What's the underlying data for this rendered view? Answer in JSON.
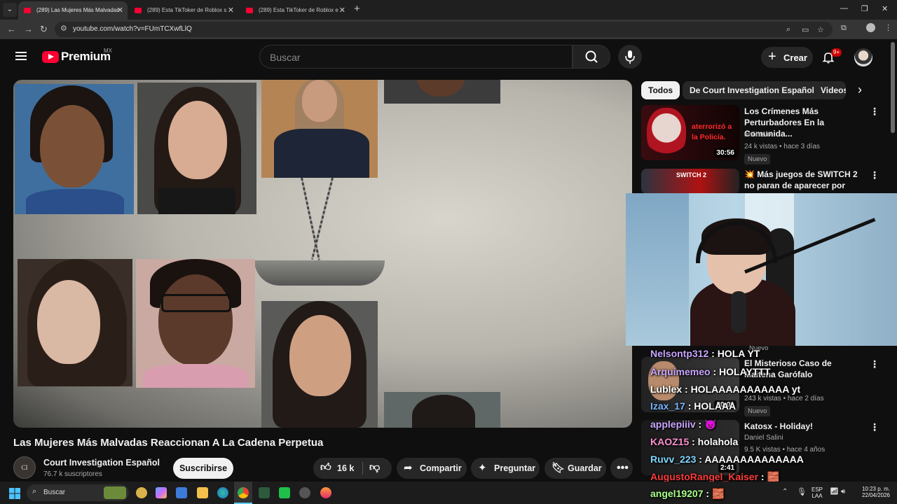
{
  "browser": {
    "tabs": [
      {
        "label": "(289) Las Mujeres Más Malvadas",
        "active": true
      },
      {
        "label": "(289) Esta TikToker de Roblox s",
        "active": false
      },
      {
        "label": "(289) Esta TikToker de Roblox e",
        "active": false
      }
    ],
    "url": "youtube.com/watch?v=FUmTCXwfLlQ"
  },
  "header": {
    "brand": "Premium",
    "country": "MX",
    "search_placeholder": "Buscar",
    "create_label": "Crear",
    "notif_count": "9+"
  },
  "video": {
    "title": "Las Mujeres Más Malvadas Reaccionan A La Cadena Perpetua",
    "channel": "Court Investigation Español",
    "channel_initials": "CI",
    "subscribers": "76.7 k suscriptores",
    "subscribe_label": "Suscribirse",
    "likes": "16 k",
    "share_label": "Compartir",
    "ask_label": "Preguntar",
    "save_label": "Guardar"
  },
  "chips": [
    "Todos",
    "De Court Investigation Español",
    "Videos"
  ],
  "recommendations": [
    {
      "title": "Los Crímenes Más Perturbadores En la Comunida...",
      "channel": "anómalo",
      "meta": "24 k vistas • hace 3 días",
      "badge": "Nuevo",
      "duration": "30:56",
      "thumb_text": "aterrorizó a la Policía."
    },
    {
      "title": "Más juegos de SWITCH 2 no paran de aparecer por sorpresa!",
      "emoji": "💥",
      "thumb_text": "SWITCH 2"
    },
    {
      "title": "El Misterioso Caso de Maitena Garófalo",
      "meta": "243 k vistas • hace 2 días",
      "badge": "Nuevo",
      "duration": "20:01",
      "partial_badge": "Nuevo"
    },
    {
      "title": "Katosx - Holiday!",
      "channel": "Daniel Salini",
      "meta": "9.5 K vistas • hace 4 años",
      "duration": "2:41"
    }
  ],
  "chat": [
    {
      "user": "Nelsontp312",
      "msg": " : HOLA YT",
      "color": "#c9a6ff"
    },
    {
      "user": "Arquimemeo",
      "msg": " : HOLAYTTT",
      "color": "#c9a6ff"
    },
    {
      "user": "Lublex",
      "msg": " : HOLAAAAAAAAAAA yt",
      "color": "#ffffff"
    },
    {
      "user": "Izax_17",
      "msg": " : HOLAAA",
      "color": "#7ab6ff"
    },
    {
      "user": "applepiiiv",
      "msg": " : 👿",
      "color": "#c9a6ff"
    },
    {
      "user": "KAOZ15",
      "msg": " : holahola",
      "color": "#ff8fd0"
    },
    {
      "user": "Ruvv_223",
      "msg": " : AAAAAAAAAAAAAA",
      "color": "#7fd8ff"
    },
    {
      "user": "AugustoRangel_Kaiser",
      "msg": " : 🧱",
      "color": "#ff3b3b"
    },
    {
      "user": "angel19207",
      "msg": " : 🧱",
      "color": "#a8ff8a"
    }
  ],
  "taskbar": {
    "search_label": "Buscar",
    "lang": "ESP",
    "lang2": "LAA",
    "time": "10:23 p. m.",
    "date": "22/04/2026"
  },
  "colors": {
    "accent": "#ff0033",
    "bg": "#0f0f0f"
  }
}
